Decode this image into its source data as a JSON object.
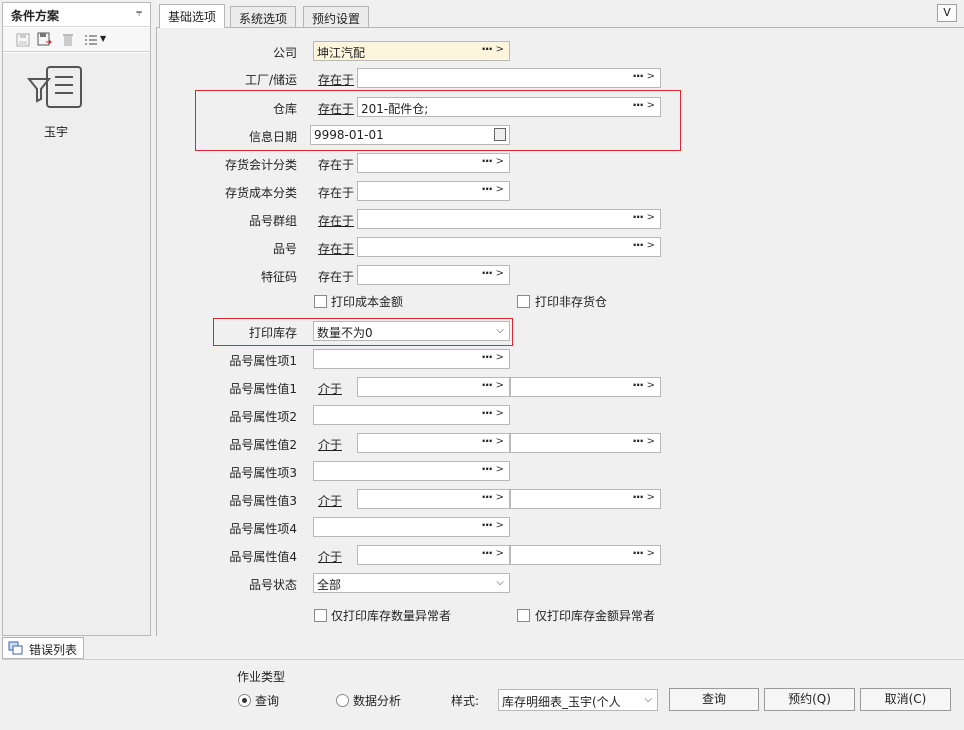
{
  "left_panel": {
    "title": "条件方案",
    "pin": "ᵖ",
    "scheme_label": "玉宇"
  },
  "tabs": [
    "基础选项",
    "系统选项",
    "预约设置"
  ],
  "v_button": "V",
  "fields": {
    "company": {
      "label": "公司",
      "value": "坤江汽配"
    },
    "factory": {
      "label": "工厂/储运",
      "op": "存在于",
      "value": ""
    },
    "warehouse": {
      "label": "仓库",
      "op": "存在于",
      "value": "201-配件仓;"
    },
    "info_date": {
      "label": "信息日期",
      "value": "9998-01-01"
    },
    "inv_acct_cat": {
      "label": "存货会计分类",
      "op": "存在于",
      "value": ""
    },
    "inv_cost_cat": {
      "label": "存货成本分类",
      "op": "存在于",
      "value": ""
    },
    "part_group": {
      "label": "品号群组",
      "op": "存在于",
      "value": ""
    },
    "part_no": {
      "label": "品号",
      "op": "存在于",
      "value": ""
    },
    "feature_code": {
      "label": "特征码",
      "op": "存在于",
      "value": ""
    },
    "print_stock": {
      "label": "打印库存",
      "value": "数量不为0"
    },
    "attr_item1": {
      "label": "品号属性项1"
    },
    "attr_val1": {
      "label": "品号属性值1",
      "op": "介于"
    },
    "attr_item2": {
      "label": "品号属性项2"
    },
    "attr_val2": {
      "label": "品号属性值2",
      "op": "介于"
    },
    "attr_item3": {
      "label": "品号属性项3"
    },
    "attr_val3": {
      "label": "品号属性值3",
      "op": "介于"
    },
    "attr_item4": {
      "label": "品号属性项4"
    },
    "attr_val4": {
      "label": "品号属性值4",
      "op": "介于"
    },
    "part_status": {
      "label": "品号状态",
      "value": "全部"
    }
  },
  "checkboxes": {
    "print_cost_amount": "打印成本金额",
    "print_non_stock_wh": "打印非存货仓",
    "print_qty_abnormal": "仅打印库存数量异常者",
    "print_amt_abnormal": "仅打印库存金额异常者"
  },
  "error_tab": "错误列表",
  "bottom": {
    "job_type_label": "作业类型",
    "radio_query": "查询",
    "radio_analysis": "数据分析",
    "style_label": "样式:",
    "style_value": "库存明细表_玉宇(个人",
    "query_button": "查询",
    "reserve_button": "预约(Q)",
    "cancel_button": "取消(C)"
  }
}
